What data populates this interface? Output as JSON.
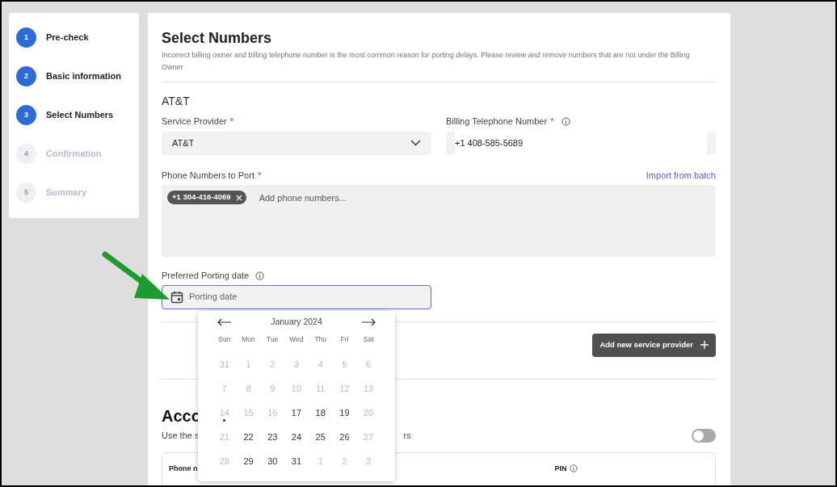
{
  "steps": [
    {
      "number": "1",
      "label": "Pre-check",
      "active": true
    },
    {
      "number": "2",
      "label": "Basic information",
      "active": true
    },
    {
      "number": "3",
      "label": "Select Numbers",
      "active": true
    },
    {
      "number": "4",
      "label": "Confirmation",
      "active": false
    },
    {
      "number": "5",
      "label": "Summary",
      "active": false
    }
  ],
  "page": {
    "title": "Select Numbers",
    "description": "Incorrect billing owner and billing telephone number is the most common reason for porting delays. Please review and remove numbers that are not under the Billing Owner"
  },
  "provider_section": {
    "title": "AT&T",
    "service_provider": {
      "label": "Service Provider",
      "required": "*",
      "value": "AT&T"
    },
    "billing_number": {
      "label": "Billing Telephone Number",
      "required": "*",
      "value": "+1 408-585-5689"
    },
    "phone_numbers": {
      "label": "Phone Numbers to Port",
      "required": "*",
      "link": "Import from batch",
      "chips": [
        "+1 304-416-4069"
      ],
      "placeholder": "Add phone numbers..."
    },
    "porting_date": {
      "label": "Preferred Porting date",
      "placeholder": "Porting date",
      "focused": true
    }
  },
  "add_provider_button": "Add new service provider",
  "account_section": {
    "title": "Acco",
    "description_start": "Use the s",
    "description_end": "rs",
    "toggle_on": false,
    "table_columns": [
      "Phone n",
      "PIN"
    ]
  },
  "calendar": {
    "month": "January 2024",
    "weekdays": [
      "Sun",
      "Mon",
      "Tue",
      "Wed",
      "Thu",
      "Fri",
      "Sat"
    ],
    "days": [
      {
        "label": "31",
        "available": false,
        "today": false
      },
      {
        "label": "1",
        "available": false,
        "today": false
      },
      {
        "label": "2",
        "available": false,
        "today": false
      },
      {
        "label": "3",
        "available": false,
        "today": false
      },
      {
        "label": "4",
        "available": false,
        "today": false
      },
      {
        "label": "5",
        "available": false,
        "today": false
      },
      {
        "label": "6",
        "available": false,
        "today": false
      },
      {
        "label": "7",
        "available": false,
        "today": false
      },
      {
        "label": "8",
        "available": false,
        "today": false
      },
      {
        "label": "9",
        "available": false,
        "today": false
      },
      {
        "label": "10",
        "available": false,
        "today": false
      },
      {
        "label": "11",
        "available": false,
        "today": false
      },
      {
        "label": "12",
        "available": false,
        "today": false
      },
      {
        "label": "13",
        "available": false,
        "today": false
      },
      {
        "label": "14",
        "available": false,
        "today": true
      },
      {
        "label": "15",
        "available": false,
        "today": false
      },
      {
        "label": "16",
        "available": false,
        "today": false
      },
      {
        "label": "17",
        "available": true,
        "today": false
      },
      {
        "label": "18",
        "available": true,
        "today": false
      },
      {
        "label": "19",
        "available": true,
        "today": false
      },
      {
        "label": "20",
        "available": false,
        "today": false
      },
      {
        "label": "21",
        "available": false,
        "today": false
      },
      {
        "label": "22",
        "available": true,
        "today": false
      },
      {
        "label": "23",
        "available": true,
        "today": false
      },
      {
        "label": "24",
        "available": true,
        "today": false
      },
      {
        "label": "25",
        "available": true,
        "today": false
      },
      {
        "label": "26",
        "available": true,
        "today": false
      },
      {
        "label": "27",
        "available": false,
        "today": false
      },
      {
        "label": "28",
        "available": false,
        "today": false
      },
      {
        "label": "29",
        "available": true,
        "today": false
      },
      {
        "label": "30",
        "available": true,
        "today": false
      },
      {
        "label": "31",
        "available": true,
        "today": false
      },
      {
        "label": "1",
        "available": false,
        "today": false
      },
      {
        "label": "2",
        "available": false,
        "today": false
      },
      {
        "label": "3",
        "available": false,
        "today": false
      }
    ]
  }
}
